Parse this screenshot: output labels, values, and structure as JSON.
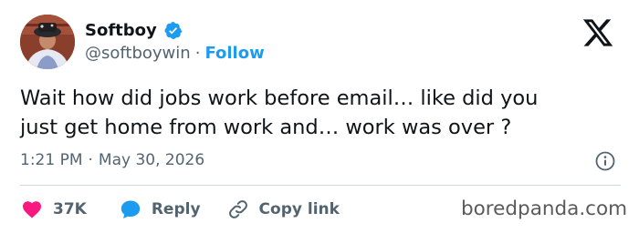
{
  "user": {
    "display_name": "Softboy",
    "handle": "@softboywin",
    "separator": "·",
    "follow_label": "Follow",
    "verified": true
  },
  "tweet": {
    "lines": [
      "Wait how did jobs work before email… like did you",
      "just get home from work and… work was over ?"
    ],
    "time": "1:21 PM",
    "separator": "·",
    "date": "May 30, 2026"
  },
  "actions": {
    "like_count": "37K",
    "reply_label": "Reply",
    "copy_label": "Copy link"
  },
  "watermark": "boredpanda.com",
  "colors": {
    "accent": "#1d9bf0",
    "like": "#f91880",
    "text": "#0f1419",
    "secondary": "#536471",
    "divider": "#cfd9de"
  },
  "icons": [
    "verified-badge-icon",
    "x-logo-icon",
    "info-icon",
    "heart-icon",
    "reply-bubble-icon",
    "link-icon"
  ]
}
